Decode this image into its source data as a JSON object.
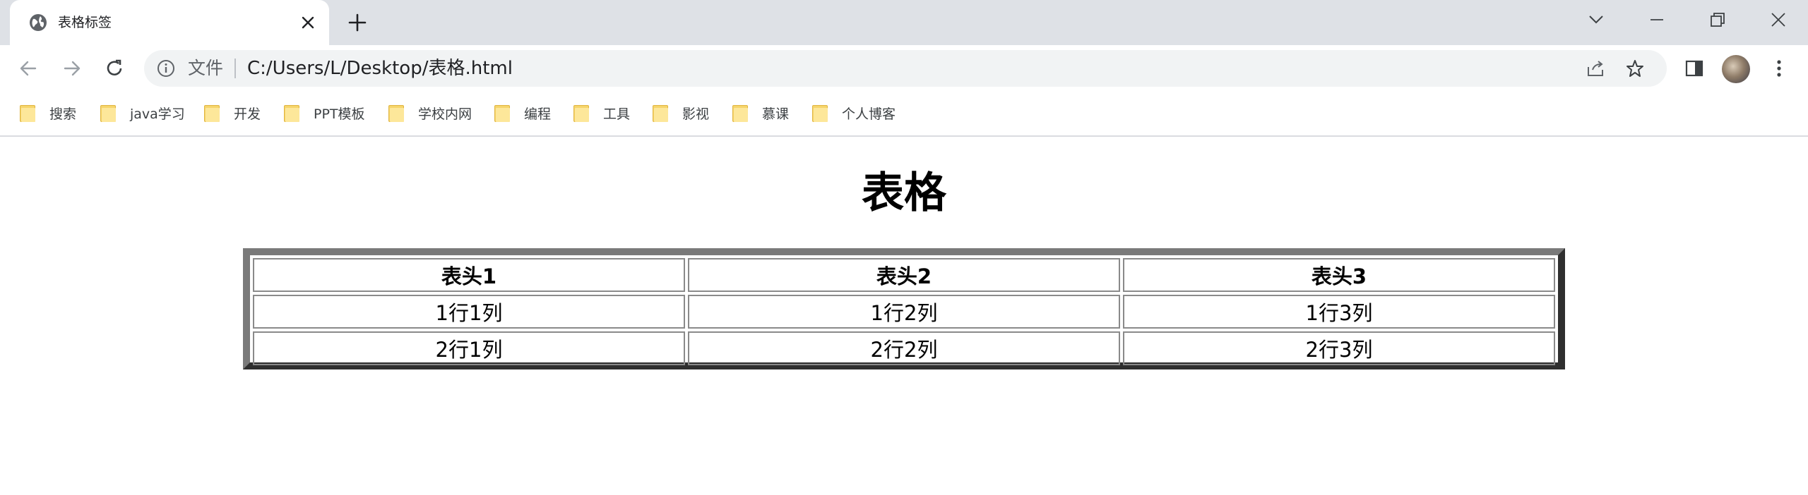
{
  "browser": {
    "tab": {
      "title": "表格标签",
      "favicon": "globe-icon"
    },
    "address_bar": {
      "scheme_label": "文件",
      "url": "C:/Users/L/Desktop/表格.html"
    },
    "bookmarks": [
      {
        "label": "搜索"
      },
      {
        "label": "java学习"
      },
      {
        "label": "开发"
      },
      {
        "label": "PPT模板"
      },
      {
        "label": "学校内网"
      },
      {
        "label": "编程"
      },
      {
        "label": "工具"
      },
      {
        "label": "影视"
      },
      {
        "label": "慕课"
      },
      {
        "label": "个人博客"
      }
    ]
  },
  "page": {
    "heading": "表格",
    "table": {
      "headers": [
        "表头1",
        "表头2",
        "表头3"
      ],
      "rows": [
        [
          "1行1列",
          "1行2列",
          "1行3列"
        ],
        [
          "2行1列",
          "2行2列",
          "2行3列"
        ]
      ]
    }
  },
  "colors": {
    "tabstrip_bg": "#dee1e6",
    "omnibox_bg": "#f1f3f4",
    "folder_yellow": "#f6d56b"
  }
}
